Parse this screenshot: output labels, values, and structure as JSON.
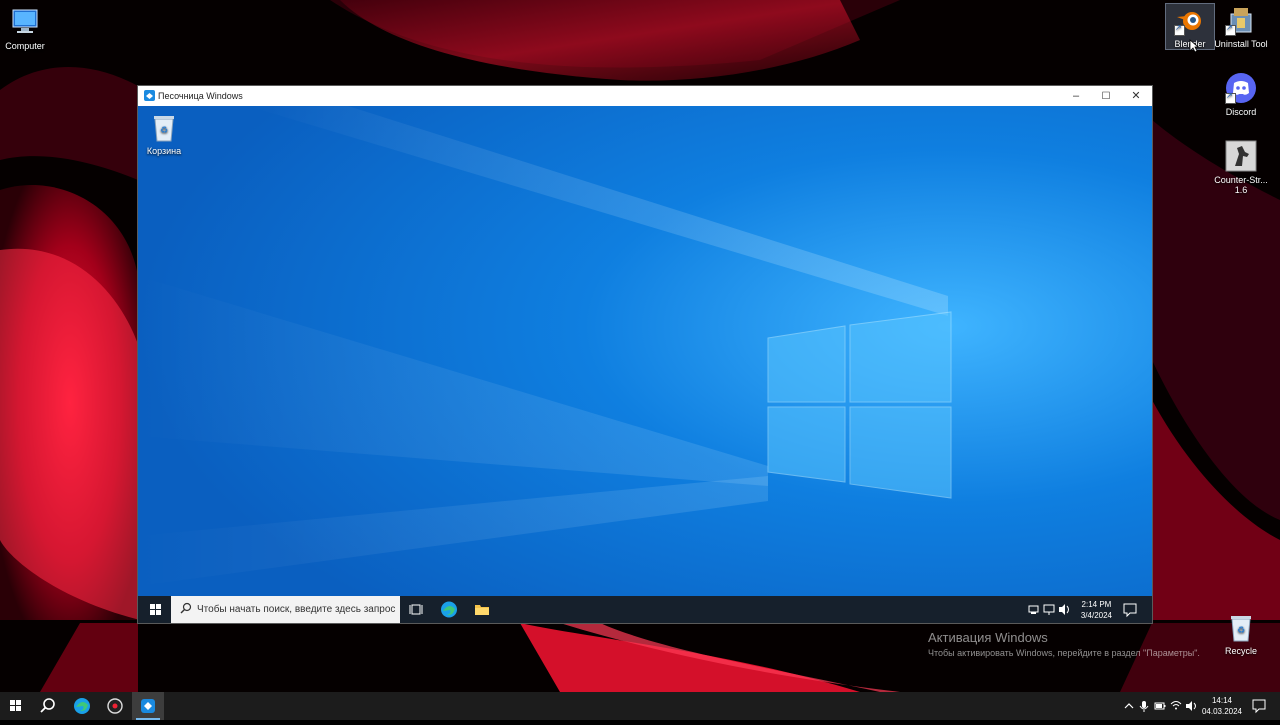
{
  "desktop": {
    "icons": [
      {
        "label": "Computer",
        "icon": "computer-icon"
      },
      {
        "label": "Blender",
        "icon": "blender-icon"
      },
      {
        "label": "Uninstall Tool",
        "icon": "uninstall-tool-icon"
      },
      {
        "label": "Discord",
        "icon": "discord-icon"
      },
      {
        "label": "Counter-Str... 1.6",
        "icon": "counter-strike-icon"
      },
      {
        "label": "Recycle",
        "icon": "recycle-bin-icon"
      }
    ]
  },
  "activation": {
    "title": "Активация Windows",
    "subtitle": "Чтобы активировать Windows, перейдите в раздел \"Параметры\"."
  },
  "sandbox": {
    "title": "Песочница Windows",
    "desktop_icons": [
      {
        "label": "Корзина",
        "icon": "recycle-bin-icon"
      }
    ],
    "search_placeholder": "Чтобы начать поиск, введите здесь запрос",
    "clock": {
      "time": "2:14 PM",
      "date": "3/4/2024"
    }
  },
  "taskbar": {
    "clock": {
      "time": "14:14",
      "date": "04.03.2024"
    }
  },
  "colors": {
    "sandbox_wallpaper": "#1a7fe0",
    "host_accent": "#e8102a",
    "taskbar": "#1c1c1c"
  }
}
